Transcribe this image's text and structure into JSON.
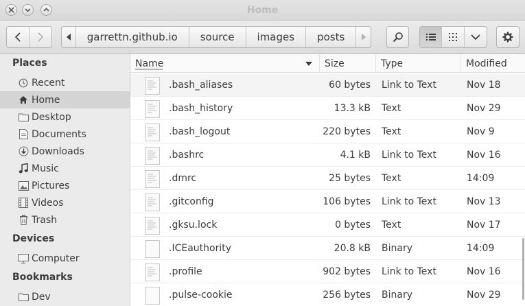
{
  "window": {
    "title": "Home"
  },
  "toolbar": {
    "breadcrumbs": [
      "garrettn.github.io",
      "source",
      "images",
      "posts"
    ]
  },
  "sidebar": {
    "sections": [
      {
        "heading": "Places"
      },
      {
        "heading": "Devices"
      },
      {
        "heading": "Bookmarks"
      }
    ],
    "places": [
      {
        "label": "Recent",
        "icon": "recent-icon"
      },
      {
        "label": "Home",
        "icon": "home-icon",
        "selected": true
      },
      {
        "label": "Desktop",
        "icon": "folder-icon"
      },
      {
        "label": "Documents",
        "icon": "documents-icon"
      },
      {
        "label": "Downloads",
        "icon": "downloads-icon"
      },
      {
        "label": "Music",
        "icon": "music-icon"
      },
      {
        "label": "Pictures",
        "icon": "pictures-icon"
      },
      {
        "label": "Videos",
        "icon": "videos-icon"
      },
      {
        "label": "Trash",
        "icon": "trash-icon"
      }
    ],
    "devices": [
      {
        "label": "Computer",
        "icon": "computer-icon"
      }
    ],
    "bookmarks": [
      {
        "label": "Dev",
        "icon": "folder-icon"
      }
    ]
  },
  "columns": {
    "name": "Name",
    "size": "Size",
    "type": "Type",
    "modified": "Modified"
  },
  "files": [
    {
      "name": ".bash_aliases",
      "size": "60 bytes",
      "type": "Link to Text",
      "modified": "Nov 18"
    },
    {
      "name": ".bash_history",
      "size": "13.3 kB",
      "type": "Text",
      "modified": "Nov 29"
    },
    {
      "name": ".bash_logout",
      "size": "220 bytes",
      "type": "Text",
      "modified": "Nov 9"
    },
    {
      "name": ".bashrc",
      "size": "4.1 kB",
      "type": "Link to Text",
      "modified": "Nov 16"
    },
    {
      "name": ".dmrc",
      "size": "25 bytes",
      "type": "Text",
      "modified": "14:09"
    },
    {
      "name": ".gitconfig",
      "size": "106 bytes",
      "type": "Link to Text",
      "modified": "Nov 13"
    },
    {
      "name": ".gksu.lock",
      "size": "0 bytes",
      "type": "Text",
      "modified": "Nov 17"
    },
    {
      "name": ".ICEauthority",
      "size": "20.8 kB",
      "type": "Binary",
      "modified": "14:09"
    },
    {
      "name": ".profile",
      "size": "902 bytes",
      "type": "Link to Text",
      "modified": "Nov 16"
    },
    {
      "name": ".pulse-cookie",
      "size": "256 bytes",
      "type": "Binary",
      "modified": "Nov 29"
    }
  ]
}
